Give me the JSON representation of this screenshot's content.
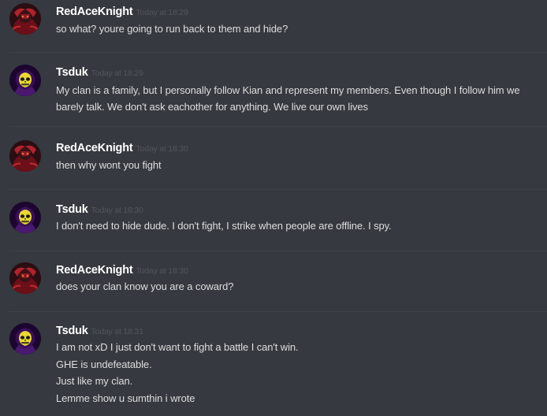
{
  "messages": [
    {
      "author": "RedAceKnight",
      "avatar_icon": "red-knight-avatar-icon",
      "timestamp": "Today at 18:29",
      "lines": [
        "so what? youre going to run back to them and hide?"
      ]
    },
    {
      "author": "Tsduk",
      "avatar_icon": "skeletor-avatar-icon",
      "timestamp": "Today at 18:29",
      "lines": [
        "My clan is a family, but I personally follow Kian and represent my members. Even though I follow him we barely talk. We don't ask eachother for anything. We live our own lives"
      ]
    },
    {
      "author": "RedAceKnight",
      "avatar_icon": "red-knight-avatar-icon",
      "timestamp": "Today at 18:30",
      "lines": [
        "then why wont you fight"
      ]
    },
    {
      "author": "Tsduk",
      "avatar_icon": "skeletor-avatar-icon",
      "timestamp": "Today at 18:30",
      "lines": [
        "I don't need to hide dude. I don't fight, I strike when people are offline. I spy."
      ]
    },
    {
      "author": "RedAceKnight",
      "avatar_icon": "red-knight-avatar-icon",
      "timestamp": "Today at 18:30",
      "lines": [
        "does your clan know you are a coward?"
      ]
    },
    {
      "author": "Tsduk",
      "avatar_icon": "skeletor-avatar-icon",
      "timestamp": "Today at 18:31",
      "lines": [
        "I am not xD I just don't want to fight a battle I can't win.",
        "GHE is undefeatable.",
        "Just like my clan.",
        "Lemme show u sumthin i wrote"
      ]
    }
  ],
  "colors": {
    "background": "#36393f",
    "username": "#ffffff",
    "timestamp": "#52565c",
    "text": "#dcddde",
    "divider": "#3f4248"
  }
}
